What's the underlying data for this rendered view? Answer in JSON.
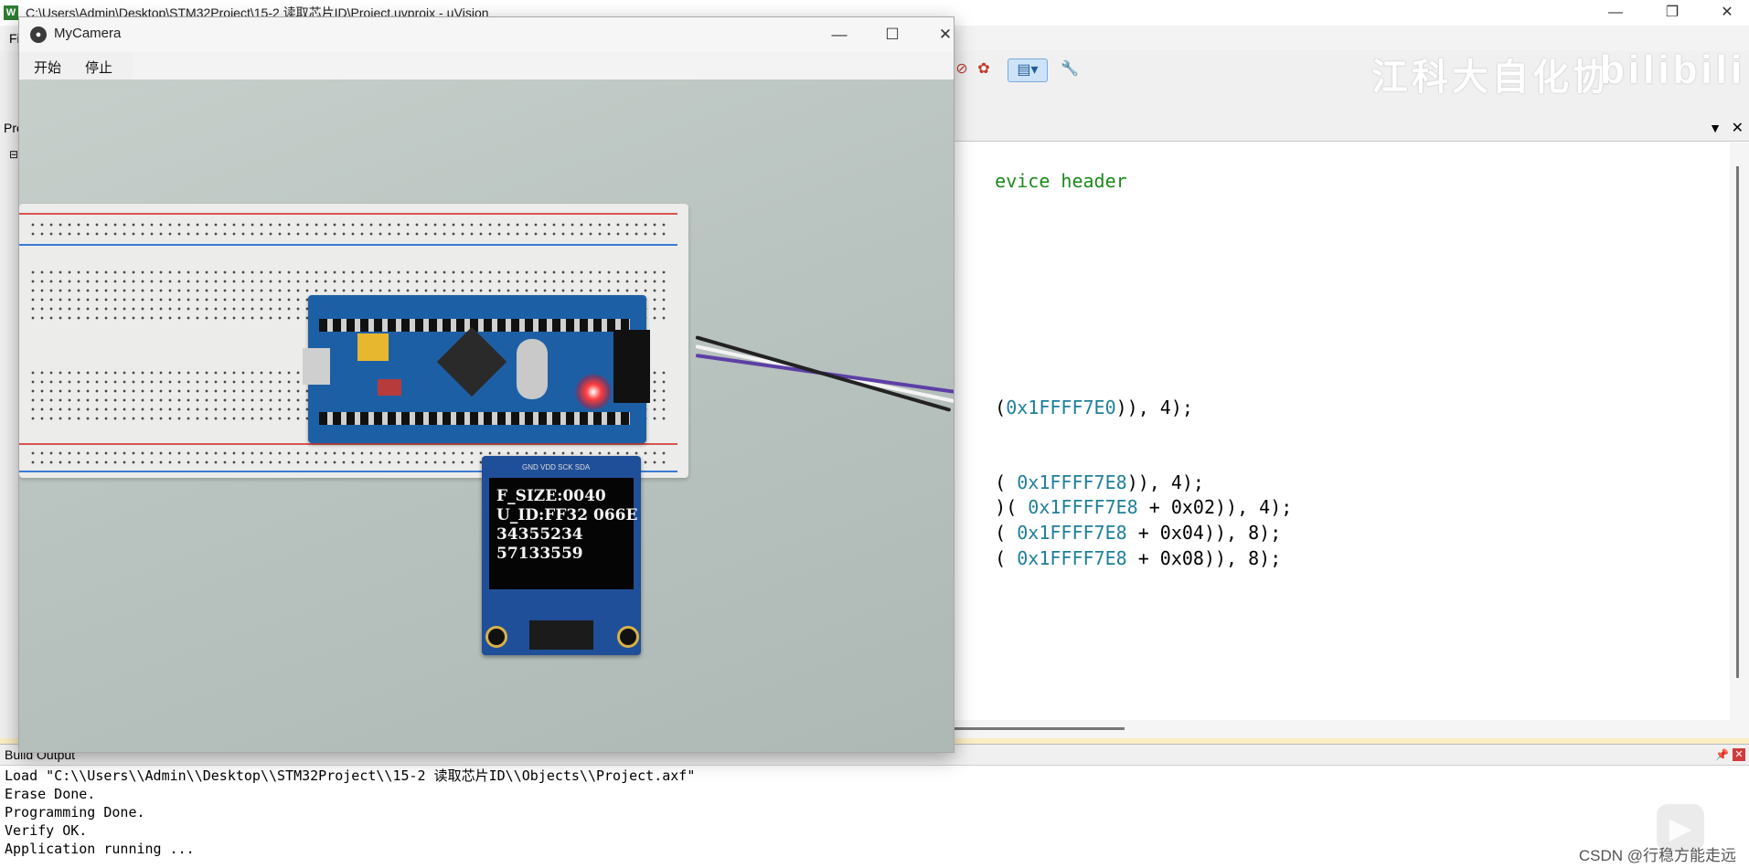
{
  "uvision": {
    "title": "C:\\Users\\Admin\\Desktop\\STM32Project\\15-2 读取芯片ID\\Project.uvprojx - µVision",
    "menu_partial": "Fi",
    "left_panel_partial": "Pro",
    "icons": [
      "minimize-icon",
      "restore-icon",
      "close-icon",
      "wrench-icon",
      "window-layout-icon"
    ]
  },
  "watermark": {
    "text": "江科大自化协",
    "logo": "bilibili"
  },
  "editor": {
    "lines": [
      {
        "comment": "evice header",
        "plain": "",
        "num": "",
        "tail": ""
      },
      {
        "plain": "(",
        "num": "0x1FFFF7E0",
        "tail": ")), 4);"
      },
      {
        "plain": "( ",
        "num": "0x1FFFF7E8",
        "tail": ")), 4);"
      },
      {
        "plain": ")( ",
        "num": "0x1FFFF7E8",
        "tail": " + 0x02)), 4);"
      },
      {
        "plain": "( ",
        "num": "0x1FFFF7E8",
        "tail": " + 0x04)), 8);"
      },
      {
        "plain": "( ",
        "num": "0x1FFFF7E8",
        "tail": " + 0x08)), 8);"
      }
    ]
  },
  "build_output": {
    "title": "Build Output",
    "lines": [
      "Load \"C:\\\\Users\\\\Admin\\\\Desktop\\\\STM32Project\\\\15-2 读取芯片ID\\\\Objects\\\\Project.axf\"",
      "Erase Done.",
      "Programming Done.",
      "Verify OK.",
      "Application running ..."
    ]
  },
  "camera": {
    "title": "MyCamera",
    "start_label": "开始",
    "stop_label": "停止"
  },
  "oled": {
    "line1": "F_SIZE:0040",
    "line2": "U_ID:FF32 066E",
    "line3": "34355234",
    "line4": "57133559",
    "pins": "GND VDD SCK SDA"
  },
  "csdn_watermark": "CSDN @行稳方能走远",
  "colors": {
    "comment": "#1a8a1a",
    "number": "#1f7f9a",
    "board_blue": "#1d5fa5",
    "separator": "#fbeec3"
  }
}
